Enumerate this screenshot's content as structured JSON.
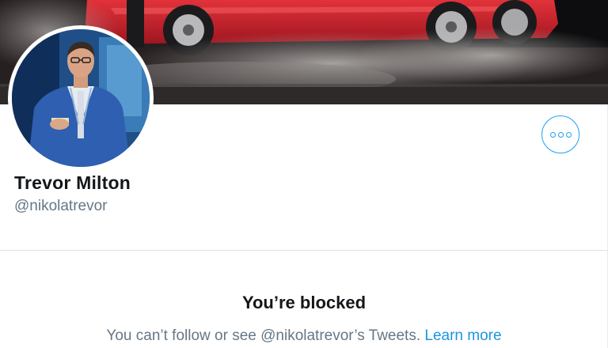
{
  "profile": {
    "display_name": "Trevor Milton",
    "handle": "@nikolatrevor"
  },
  "banner": {
    "icon": "banner-photo-red-truck"
  },
  "avatar": {
    "icon": "profile-photo-man-blue-suit"
  },
  "actions": {
    "more_icon": "more-horizontal-icon"
  },
  "blocked_notice": {
    "title": "You’re blocked",
    "message": "You can’t follow or see @nikolatrevor’s Tweets.",
    "link_label": "Learn more"
  },
  "colors": {
    "accent": "#1da1f2",
    "link": "#1b95e0",
    "secondary_text": "#657786",
    "primary_text": "#14171a"
  }
}
